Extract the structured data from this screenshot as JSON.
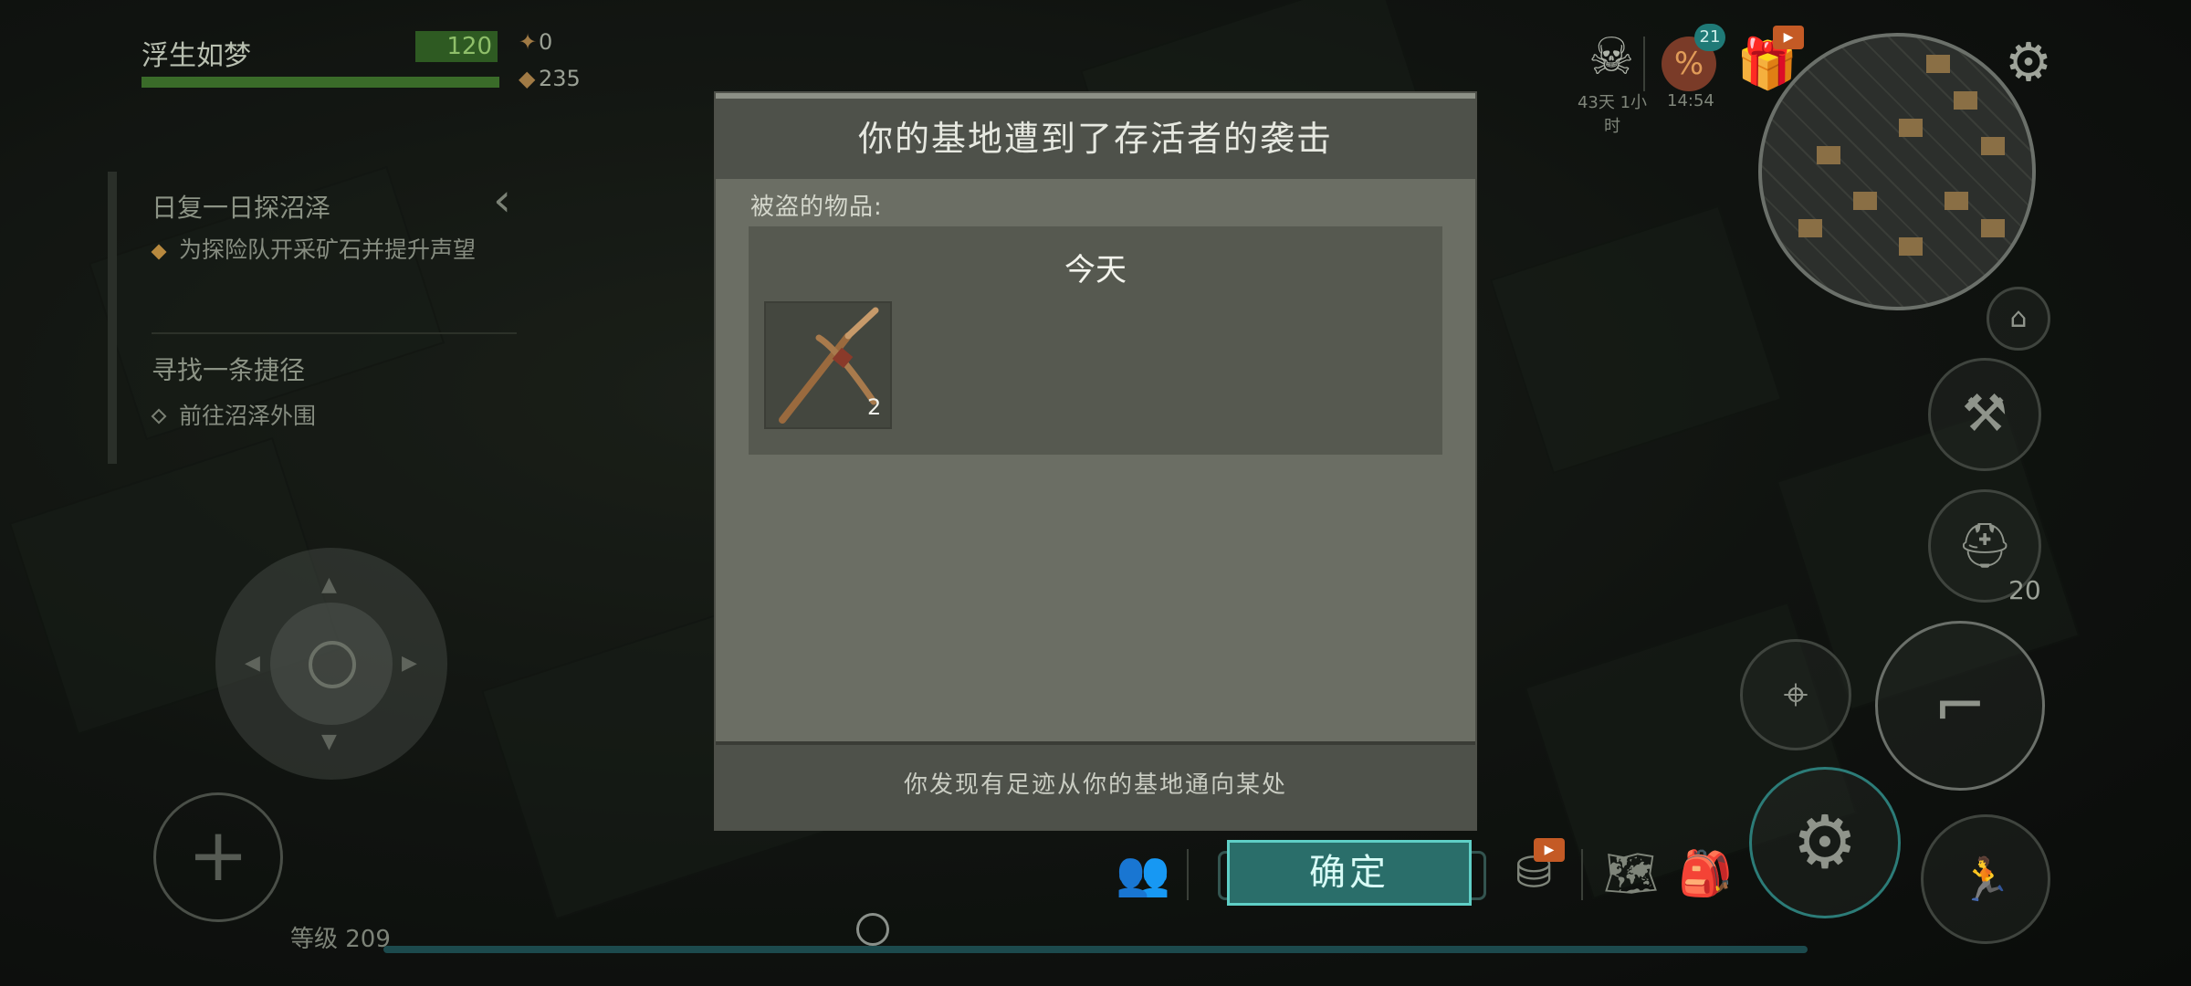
{
  "player": {
    "name": "浮生如梦",
    "hp": "120",
    "res_1": "0",
    "res_2": "235"
  },
  "quests": [
    {
      "title": "日复一日探沼泽",
      "task": "为探险队开采矿石并提升声望"
    },
    {
      "title": "寻找一条捷径",
      "task": "前往沼泽外围"
    }
  ],
  "raid_timer": "43天 1小时",
  "shop": {
    "badge": "21",
    "time": "14:54"
  },
  "level_label": "等级 209",
  "ammo_count": "20",
  "dialog": {
    "title": "你的基地遭到了存活者的袭击",
    "stolen_label": "被盗的物品:",
    "day_label": "今天",
    "item": {
      "name": "pickaxe",
      "count": "2"
    },
    "footer_text": "你发现有足迹从你的基地通向某处",
    "confirm_label": "确定"
  },
  "colors": {
    "accent": "#5fcfc6",
    "hp": "#3a6b29",
    "dialog_bg": "#6b6e64",
    "header_bg": "#4e514a"
  }
}
